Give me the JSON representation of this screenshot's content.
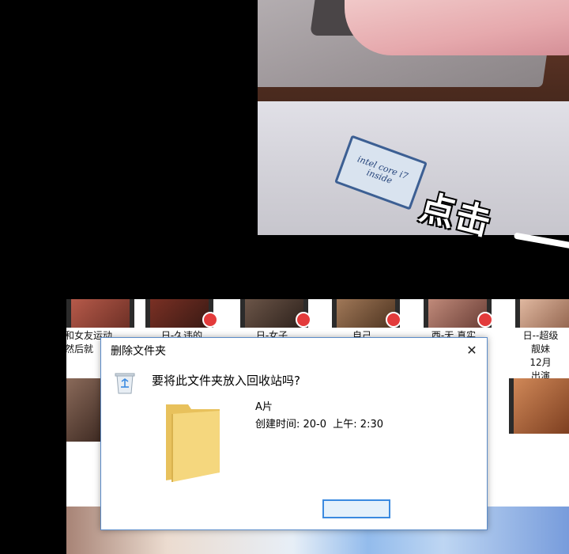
{
  "comic": {
    "sticker_text": "intel core i7 inside",
    "sound_effect": "点击"
  },
  "explorer": {
    "files": [
      {
        "label": "和女友运动\n然后就"
      },
      {
        "label": "日-久违的"
      },
      {
        "label": "日-女子"
      },
      {
        "label": "自己"
      },
      {
        "label": "西-无 真实"
      },
      {
        "label": "日--超级\n靓妹\n12月\n出演"
      }
    ]
  },
  "dialog": {
    "title": "删除文件夹",
    "close_glyph": "✕",
    "question": "要将此文件夹放入回收站吗?",
    "file_name": "A片",
    "created_label": "创建时间: 20-0  上午: 2:30",
    "yes_label": ""
  },
  "colors": {
    "dialog_border": "#5b8cc9",
    "button_border": "#3b8ae0",
    "folder": "#f5d77e"
  }
}
